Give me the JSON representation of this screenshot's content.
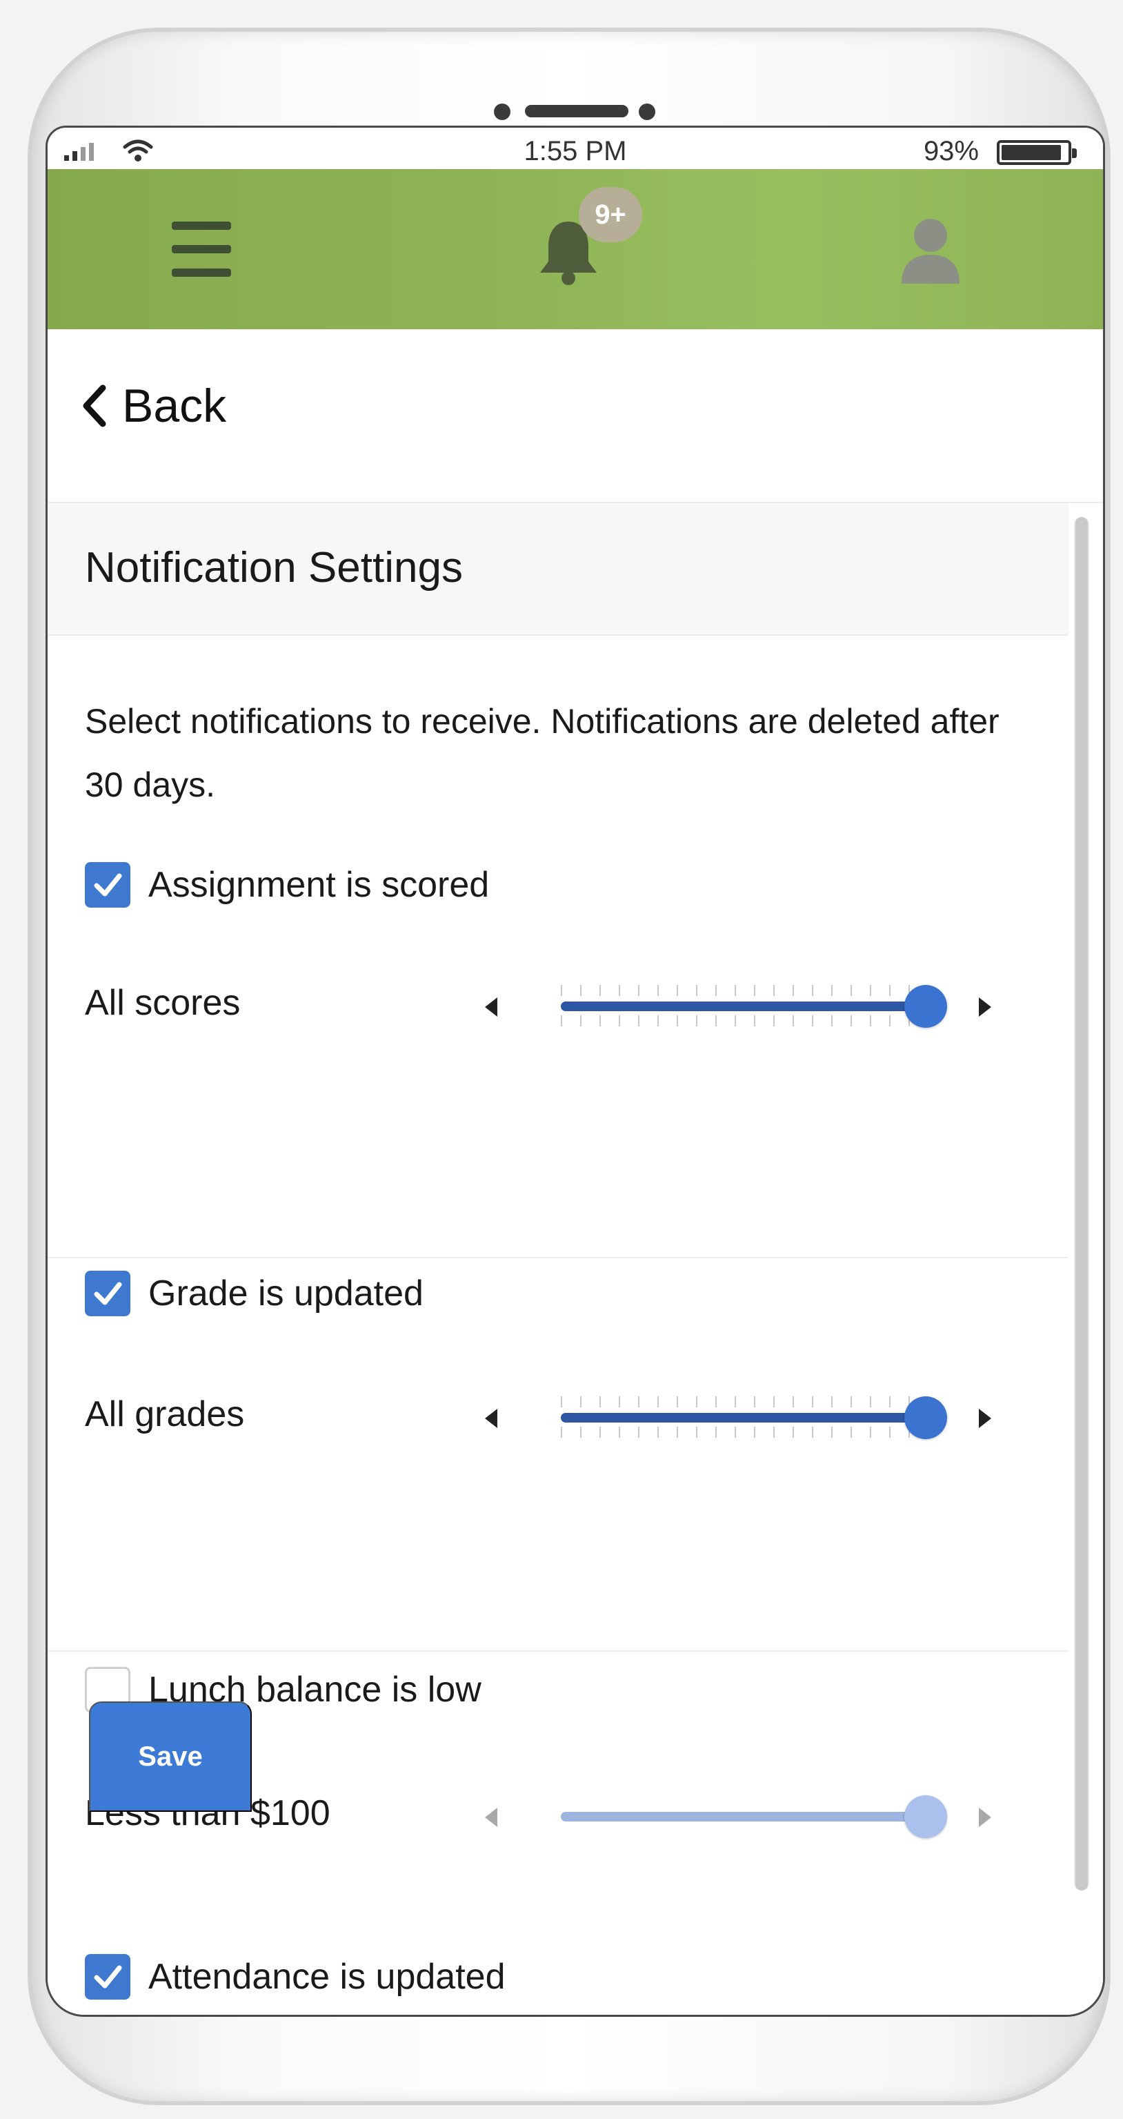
{
  "status_bar": {
    "time": "1:55 PM",
    "battery_percent": "93%",
    "battery_level": 0.93,
    "icons": [
      "signal-icon",
      "wifi-icon",
      "battery-icon"
    ]
  },
  "header": {
    "icons": [
      "menu-icon",
      "bell-icon",
      "user-avatar-icon"
    ],
    "notification_badge": "9+",
    "accent_color": "#8fb457"
  },
  "nav": {
    "back_label": "Back"
  },
  "settings": {
    "title": "Notification Settings",
    "intro": "Select notifications to receive. Notifications are deleted after 30 days.",
    "items": [
      {
        "label": "Assignment is scored",
        "checked": true,
        "slider_label": "All scores",
        "slider_value": 1.0,
        "enabled": true
      },
      {
        "label": "Grade is updated",
        "checked": true,
        "slider_label": "All grades",
        "slider_value": 1.0,
        "enabled": true
      },
      {
        "label": "Lunch balance is low",
        "checked": false,
        "slider_label": "Less than $100",
        "slider_value": 1.0,
        "enabled": false
      },
      {
        "label": "Attendance is updated",
        "checked": true
      }
    ],
    "save_label": "Save",
    "primary_color": "#3d7ad6"
  }
}
